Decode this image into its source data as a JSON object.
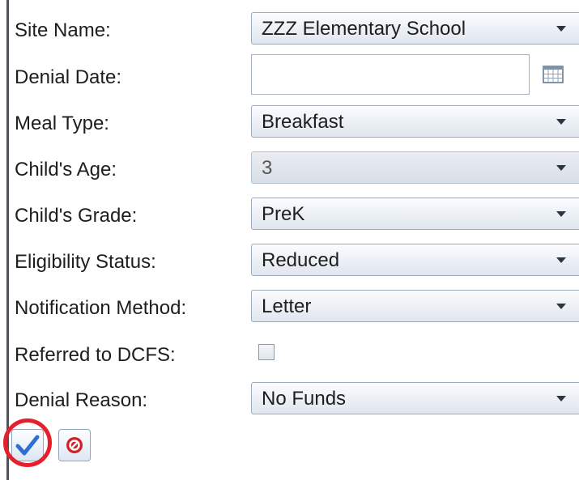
{
  "form": {
    "site_name": {
      "label": "Site Name:",
      "value": "ZZZ Elementary School"
    },
    "denial_date": {
      "label": "Denial Date:",
      "value": ""
    },
    "meal_type": {
      "label": "Meal Type:",
      "value": "Breakfast"
    },
    "childs_age": {
      "label": "Child's Age:",
      "value": "3"
    },
    "childs_grade": {
      "label": "Child's Grade:",
      "value": "PreK"
    },
    "eligibility_status": {
      "label": "Eligibility Status:",
      "value": "Reduced"
    },
    "notification_method": {
      "label": "Notification Method:",
      "value": "Letter"
    },
    "referred_to_dcfs": {
      "label": "Referred to DCFS:",
      "checked": false
    },
    "denial_reason": {
      "label": "Denial Reason:",
      "value": "No Funds"
    }
  },
  "icons": {
    "calendar": "calendar-icon",
    "save": "checkmark-icon",
    "cancel": "cancel-icon",
    "dropdown": "chevron-down-icon"
  },
  "colors": {
    "highlight": "#e3202b",
    "check_blue": "#2f6fd1",
    "cancel_red": "#d4202a"
  }
}
